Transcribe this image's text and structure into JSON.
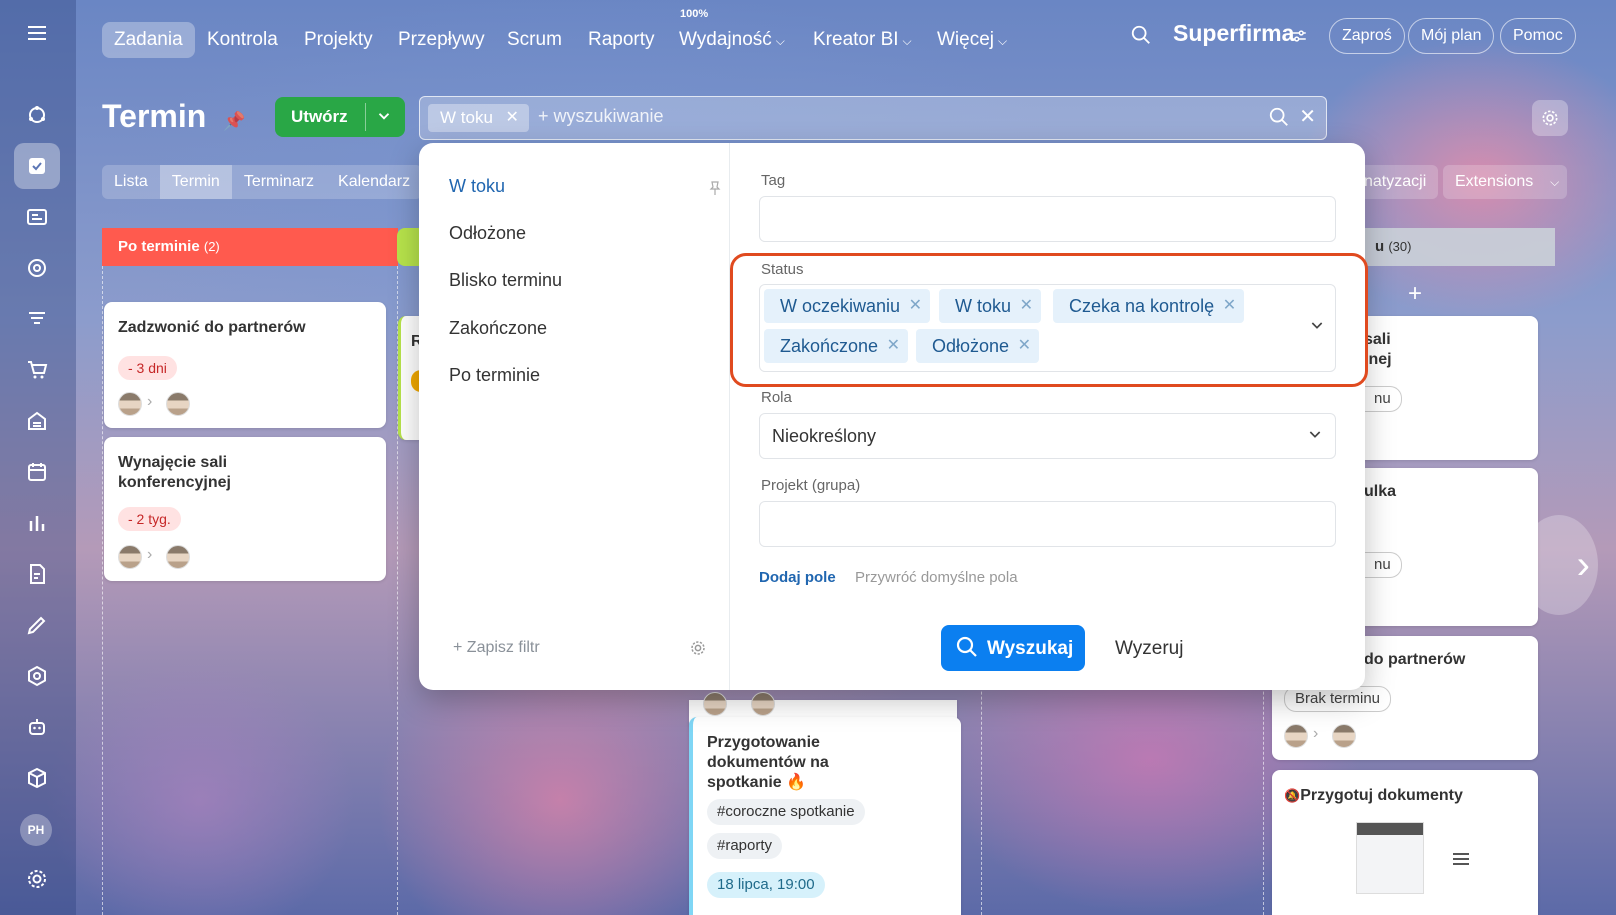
{
  "app": {
    "brand": "Superfirma"
  },
  "nav": {
    "items": [
      "Zadania",
      "Kontrola",
      "Projekty",
      "Przepływy",
      "Scrum",
      "Raporty",
      "Wydajność",
      "Kreator BI",
      "Więcej"
    ],
    "percent": "100%",
    "invite": "Zaproś",
    "my_plan": "Mój plan",
    "help": "Pomoc"
  },
  "page": {
    "title": "Termin",
    "create_label": "Utwórz"
  },
  "search": {
    "active_chip": "W toku",
    "placeholder": "+ wyszukiwanie"
  },
  "view_tabs": [
    "Lista",
    "Termin",
    "Terminarz",
    "Kalendarz"
  ],
  "right_tabs": {
    "automation": "natyzacji",
    "extensions": "Extensions"
  },
  "columns": {
    "overdue": {
      "title": "Po terminie",
      "count": "(2)"
    },
    "right": {
      "title": "u",
      "count": "(30)"
    }
  },
  "cards": {
    "c1": {
      "title": "Zadzwonić do partnerów",
      "deadline": "- 3 dni"
    },
    "c2": {
      "title": "Wynajęcie sali konferencyjnej",
      "deadline": "- 2 tyg."
    },
    "c3": {
      "title": "R"
    },
    "c4": {
      "title": "Przygotowanie dokumentów na spotkanie",
      "fire": "🔥",
      "tags": [
        "#coroczne spotkanie",
        "#raporty"
      ],
      "date": "18 lipca, 19:00"
    },
    "r1": {
      "title": "sali\njnej",
      "pill": "nu"
    },
    "r2": {
      "title": "ulka",
      "pill": "nu"
    },
    "r3": {
      "title": "do partnerów",
      "pill": "Brak terminu"
    },
    "r4": {
      "title": "Przygotuj dokumenty"
    },
    "plus": "+"
  },
  "filter": {
    "presets": [
      "W toku",
      "Odłożone",
      "Blisko terminu",
      "Zakończone",
      "Po terminie"
    ],
    "save_filter": "Zapisz filtr",
    "tag_label": "Tag",
    "status_label": "Status",
    "status_chips": [
      "W oczekiwaniu",
      "W toku",
      "Czeka na kontrolę",
      "Zakończone",
      "Odłożone"
    ],
    "role_label": "Rola",
    "role_value": "Nieokreślony",
    "project_label": "Projekt (grupa)",
    "add_field": "Dodaj pole",
    "restore_fields": "Przywróć domyślne pola",
    "search_button": "Wyszukaj",
    "reset_button": "Wyzeruj"
  },
  "user_initials": "PH",
  "colors": {
    "accent": "#0b7ff0",
    "create": "#29a746",
    "overdue": "#ff5a4e",
    "highlight": "#e04a1f",
    "chip_bg": "#e5f1fb"
  }
}
